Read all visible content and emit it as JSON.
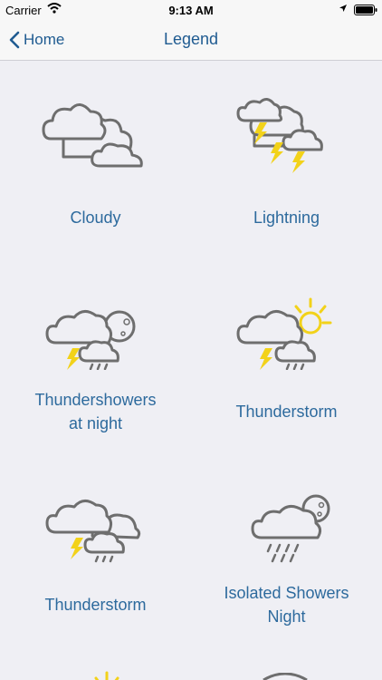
{
  "status_bar": {
    "carrier": "Carrier",
    "time": "9:13 AM"
  },
  "nav": {
    "back_label": "Home",
    "title": "Legend"
  },
  "tiles": [
    {
      "label": "Cloudy",
      "icon": "cloudy-icon"
    },
    {
      "label": "Lightning",
      "icon": "lightning-icon"
    },
    {
      "label": "Thundershowers\nat night",
      "icon": "thundershowers-night-icon"
    },
    {
      "label": "Thunderstorm",
      "icon": "thunderstorm-sun-icon"
    },
    {
      "label": "Thunderstorm",
      "icon": "thunderstorm-icon"
    },
    {
      "label": "Isolated Showers\nNight",
      "icon": "isolated-showers-night-icon"
    }
  ],
  "colors": {
    "accent": "#1f5b91",
    "label": "#2d6a9d",
    "icon_stroke": "#6e6e6e",
    "bolt": "#f2d21a",
    "sun": "#f2d21a"
  }
}
